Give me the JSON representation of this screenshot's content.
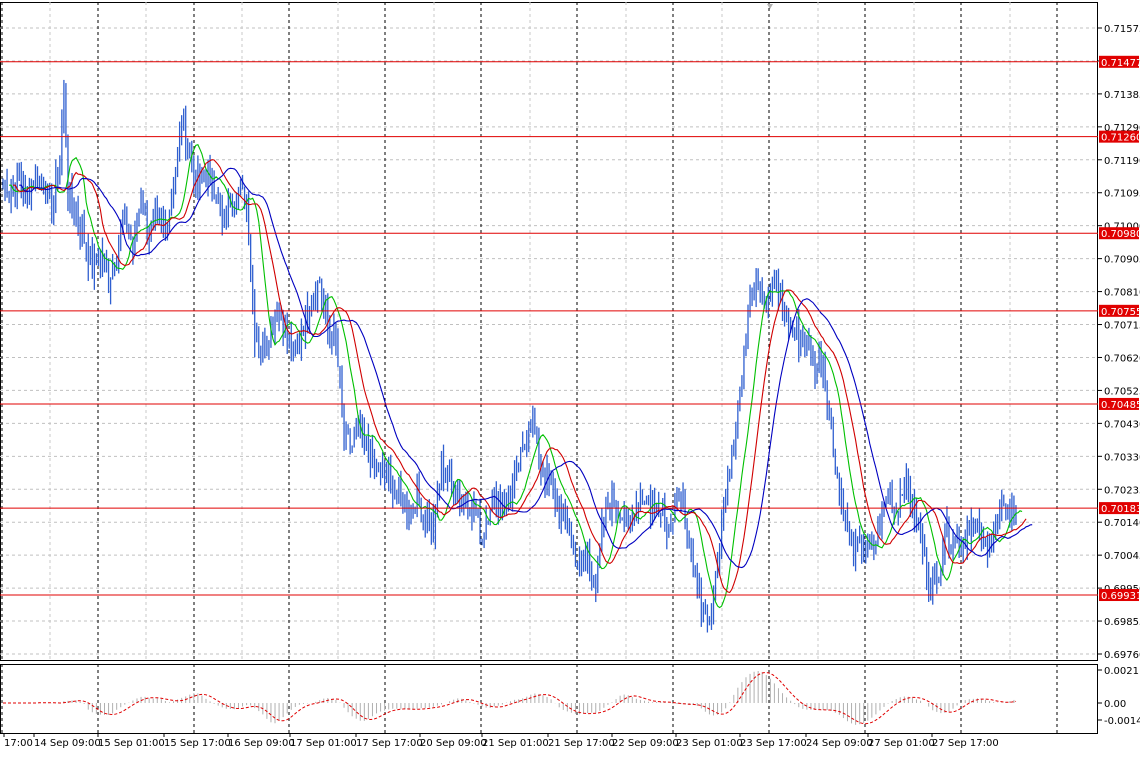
{
  "chart_data": [
    {
      "type": "candlestick",
      "title": "",
      "ylim": [
        0.6976,
        0.71575
      ],
      "y_ticks": [
        "0.71575",
        "0.71480",
        "0.71385",
        "0.71290",
        "0.71190",
        "0.71095",
        "0.71000",
        "0.70905",
        "0.70810",
        "0.70715",
        "0.70620",
        "0.70525",
        "0.70430",
        "0.70330",
        "0.70235",
        "0.70140",
        "0.70045",
        "0.69950",
        "0.69855",
        "0.69760"
      ],
      "x_ticks": [
        "17:00",
        "14 Sep 09:00",
        "15 Sep 01:00",
        "15 Sep 17:00",
        "16 Sep 09:00",
        "17 Sep 01:00",
        "17 Sep 17:00",
        "20 Sep 09:00",
        "21 Sep 01:00",
        "21 Sep 17:00",
        "22 Sep 09:00",
        "23 Sep 01:00",
        "23 Sep 17:00",
        "24 Sep 09:00",
        "27 Sep 01:00",
        "27 Sep 17:00"
      ],
      "horizontal_levels": [
        "0.71477",
        "0.71260",
        "0.70980",
        "0.70755",
        "0.70485",
        "0.70183",
        "0.69931"
      ],
      "level_color": "#e00000",
      "bar_color": "#2f5fd0",
      "ma_colors": {
        "fast": "#00c000",
        "medium": "#d00000",
        "slow": "#0000c0"
      },
      "price_path": [
        [
          0,
          0.7112
        ],
        [
          4,
          0.711
        ],
        [
          8,
          0.7114
        ],
        [
          12,
          0.7108
        ],
        [
          16,
          0.7115
        ],
        [
          20,
          0.7112
        ],
        [
          24,
          0.7106
        ],
        [
          28,
          0.7118
        ],
        [
          30,
          0.714
        ],
        [
          32,
          0.711
        ],
        [
          36,
          0.7104
        ],
        [
          40,
          0.7096
        ],
        [
          44,
          0.7088
        ],
        [
          48,
          0.7092
        ],
        [
          52,
          0.7084
        ],
        [
          56,
          0.7094
        ],
        [
          60,
          0.7102
        ],
        [
          64,
          0.7094
        ],
        [
          68,
          0.7108
        ],
        [
          72,
          0.7098
        ],
        [
          76,
          0.7102
        ],
        [
          80,
          0.71
        ],
        [
          84,
          0.7112
        ],
        [
          88,
          0.713
        ],
        [
          92,
          0.712
        ],
        [
          96,
          0.711
        ],
        [
          100,
          0.7116
        ],
        [
          104,
          0.7112
        ],
        [
          108,
          0.71
        ],
        [
          112,
          0.7108
        ],
        [
          116,
          0.711
        ],
        [
          120,
          0.7108
        ],
        [
          124,
          0.707
        ],
        [
          128,
          0.7064
        ],
        [
          132,
          0.7072
        ],
        [
          136,
          0.7076
        ],
        [
          140,
          0.7068
        ],
        [
          144,
          0.7062
        ],
        [
          148,
          0.7072
        ],
        [
          152,
          0.708
        ],
        [
          156,
          0.7084
        ],
        [
          160,
          0.707
        ],
        [
          164,
          0.7066
        ],
        [
          168,
          0.704
        ],
        [
          172,
          0.7036
        ],
        [
          176,
          0.704
        ],
        [
          180,
          0.7034
        ],
        [
          184,
          0.703
        ],
        [
          188,
          0.7028
        ],
        [
          192,
          0.7025
        ],
        [
          196,
          0.702
        ],
        [
          200,
          0.7018
        ],
        [
          204,
          0.7021
        ],
        [
          208,
          0.7016
        ],
        [
          212,
          0.7012
        ],
        [
          216,
          0.703
        ],
        [
          220,
          0.7026
        ],
        [
          224,
          0.7022
        ],
        [
          228,
          0.702
        ],
        [
          232,
          0.7018
        ],
        [
          236,
          0.701
        ],
        [
          240,
          0.702
        ],
        [
          244,
          0.7022
        ],
        [
          248,
          0.7018
        ],
        [
          252,
          0.7026
        ],
        [
          256,
          0.7034
        ],
        [
          260,
          0.7046
        ],
        [
          264,
          0.7032
        ],
        [
          268,
          0.7026
        ],
        [
          272,
          0.702
        ],
        [
          276,
          0.7016
        ],
        [
          280,
          0.701
        ],
        [
          284,
          0.7
        ],
        [
          288,
          0.7005
        ],
        [
          292,
          0.6996
        ],
        [
          296,
          0.7016
        ],
        [
          300,
          0.7022
        ],
        [
          304,
          0.7018
        ],
        [
          308,
          0.7012
        ],
        [
          312,
          0.702
        ],
        [
          316,
          0.7022
        ],
        [
          320,
          0.7018
        ],
        [
          324,
          0.702
        ],
        [
          328,
          0.7012
        ],
        [
          332,
          0.7022
        ],
        [
          336,
          0.7016
        ],
        [
          340,
          0.6998
        ],
        [
          344,
          0.6992
        ],
        [
          348,
          0.6986
        ],
        [
          352,
          0.7
        ],
        [
          356,
          0.7024
        ],
        [
          360,
          0.704
        ],
        [
          364,
          0.7055
        ],
        [
          368,
          0.7082
        ],
        [
          372,
          0.7086
        ],
        [
          376,
          0.7078
        ],
        [
          380,
          0.7084
        ],
        [
          384,
          0.7076
        ],
        [
          388,
          0.707
        ],
        [
          392,
          0.7068
        ],
        [
          396,
          0.7066
        ],
        [
          400,
          0.706
        ],
        [
          404,
          0.706
        ],
        [
          408,
          0.704
        ],
        [
          412,
          0.7024
        ],
        [
          416,
          0.7012
        ],
        [
          420,
          0.7006
        ],
        [
          424,
          0.7008
        ],
        [
          428,
          0.7004
        ],
        [
          432,
          0.7014
        ],
        [
          436,
          0.7022
        ],
        [
          440,
          0.7018
        ],
        [
          444,
          0.7026
        ],
        [
          448,
          0.7018
        ],
        [
          452,
          0.701
        ],
        [
          456,
          0.6998
        ],
        [
          460,
          0.6996
        ],
        [
          464,
          0.7012
        ],
        [
          468,
          0.701
        ],
        [
          472,
          0.7008
        ],
        [
          476,
          0.7014
        ],
        [
          480,
          0.7012
        ],
        [
          484,
          0.7006
        ],
        [
          488,
          0.7012
        ],
        [
          492,
          0.7016
        ],
        [
          496,
          0.7018
        ],
        [
          500,
          0.7016
        ],
        [
          504,
          0.702
        ]
      ]
    },
    {
      "type": "oscillator",
      "title": "",
      "y_ticks": [
        "0.002113",
        "0.00",
        "-0.00146"
      ],
      "histogram_color": "#b0b0b0",
      "signal_color": "#e00000"
    }
  ]
}
